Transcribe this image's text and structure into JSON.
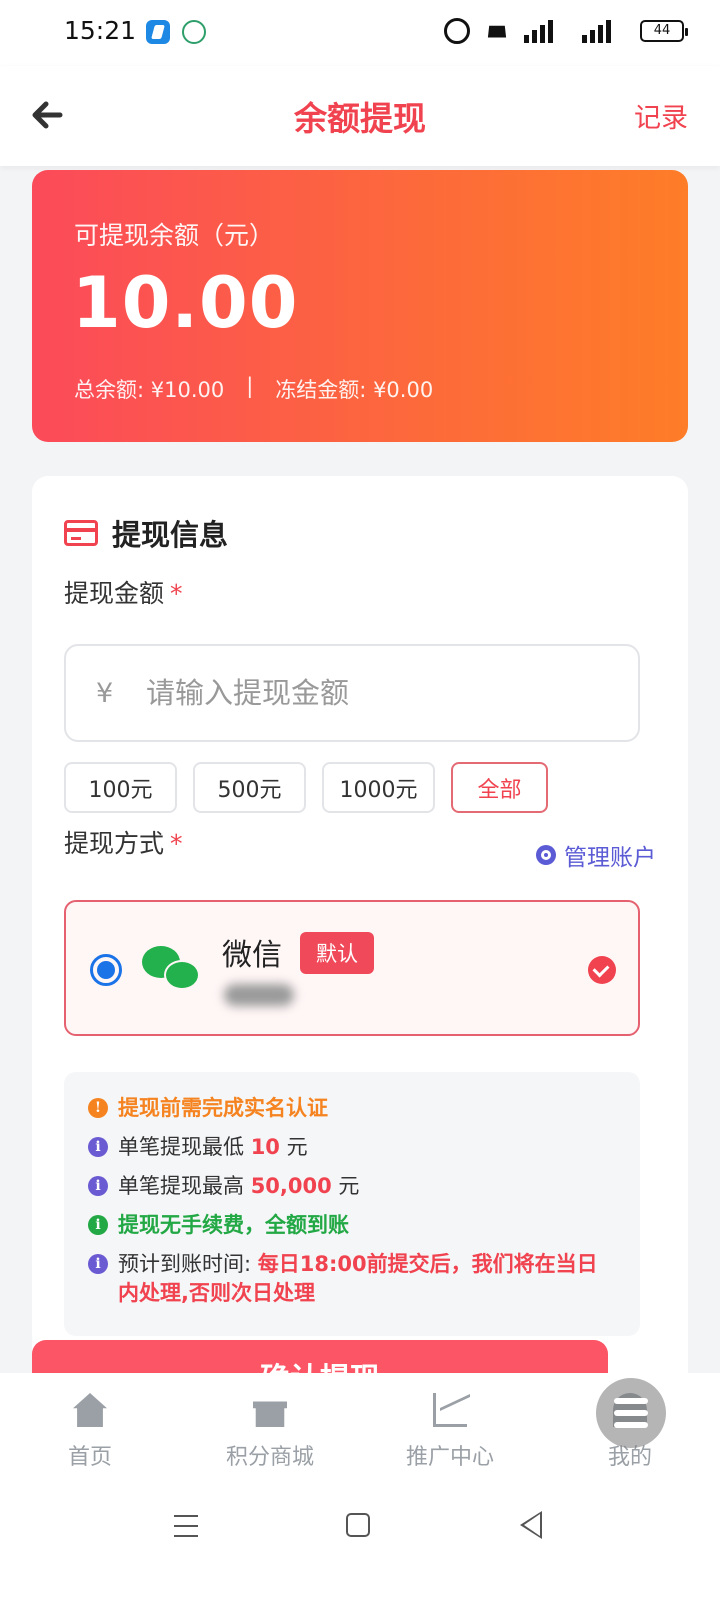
{
  "status_bar": {
    "time": "15:21",
    "network_1": "4G",
    "network_2": "5G",
    "battery": "44"
  },
  "header": {
    "title": "余额提现",
    "record_label": "记录"
  },
  "balance_card": {
    "label": "可提现余额（元）",
    "amount": "10.00",
    "total_label": "总余额: ¥10.00",
    "separator": "|",
    "frozen_label": "冻结金额: ¥0.00"
  },
  "form": {
    "section_title": "提现信息",
    "amount_label": "提现金额",
    "required_mark": "*",
    "currency_symbol": "¥",
    "amount_placeholder": "请输入提现金额",
    "amount_value": "",
    "quick_amounts": [
      "100元",
      "500元",
      "1000元",
      "全部"
    ],
    "method_label": "提现方式",
    "manage_label": "管理账户",
    "method": {
      "name": "微信",
      "badge": "默认",
      "selected": true
    }
  },
  "notice": {
    "line1": "提现前需完成实名认证",
    "line2_prefix": "单笔提现最低",
    "line2_value": "10",
    "line2_suffix": "元",
    "line3_prefix": "单笔提现最高",
    "line3_value": "50,000",
    "line3_suffix": "元",
    "line4": "提现无手续费，全额到账",
    "line5_prefix": "预计到账时间:",
    "line5_value": "每日18:00前提交后，我们将在当日内处理,否则次日处理"
  },
  "submit_label": "确认提现",
  "bottom_nav": {
    "items": [
      {
        "label": "首页",
        "icon": "home-icon"
      },
      {
        "label": "积分商城",
        "icon": "gift-icon"
      },
      {
        "label": "推广中心",
        "icon": "trend-icon"
      },
      {
        "label": "我的",
        "icon": "user-icon"
      }
    ]
  },
  "colors": {
    "accent": "#f0434f",
    "gradient_start": "#fb4a5a",
    "gradient_end": "#fe7d28",
    "link": "#5b5bd6",
    "success": "#22a844",
    "warning": "#f5831f"
  }
}
